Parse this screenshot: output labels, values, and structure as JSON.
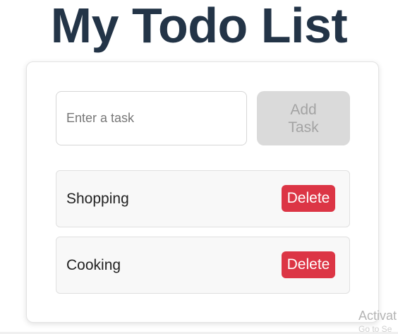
{
  "app": {
    "title": "My Todo List"
  },
  "input": {
    "placeholder": "Enter a task",
    "value": ""
  },
  "add_button": {
    "label": "Add Task",
    "disabled": true
  },
  "tasks": [
    {
      "label": "Shopping",
      "delete_label": "Delete"
    },
    {
      "label": "Cooking",
      "delete_label": "Delete"
    }
  ],
  "watermark": {
    "line1": "Activat",
    "line2": "Go to Se"
  },
  "colors": {
    "title": "#233447",
    "delete": "#dc3545",
    "add_disabled_bg": "#dadada",
    "add_disabled_text": "#a3a3a3"
  }
}
